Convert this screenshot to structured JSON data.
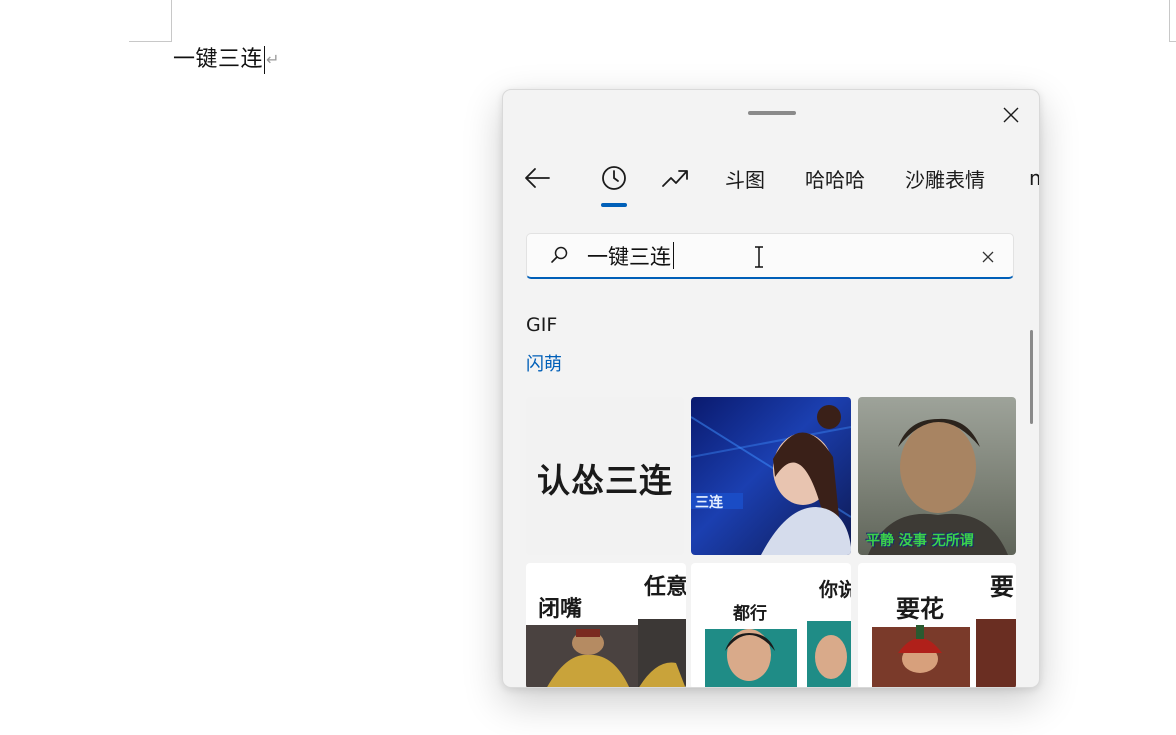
{
  "document": {
    "body_text": "一键三连",
    "paragraph_mark": "↵"
  },
  "panel": {
    "close_icon": "close-icon",
    "nav": {
      "back_icon": "arrow-left-icon",
      "recent_icon": "clock-icon",
      "trending_icon": "trending-up-icon",
      "tabs": [
        "斗图",
        "哈哈哈",
        "沙雕表情",
        "m"
      ]
    },
    "search": {
      "value": "一键三连",
      "search_icon": "search-icon",
      "clear_icon": "close-icon"
    },
    "section": {
      "title": "GIF",
      "link": "闪萌"
    },
    "gifs": [
      {
        "caption": "认怂三连"
      },
      {
        "caption": "三连"
      },
      {
        "caption": "平静 没事 无所谓"
      },
      {
        "caption_left": "闭嘴",
        "caption_right": "任意"
      },
      {
        "caption_left": "都行",
        "caption_right": "你说"
      },
      {
        "caption_left": "要花",
        "caption_right": "要"
      }
    ]
  },
  "colors": {
    "accent": "#005fb8",
    "panel_bg": "#f3f3f3"
  }
}
